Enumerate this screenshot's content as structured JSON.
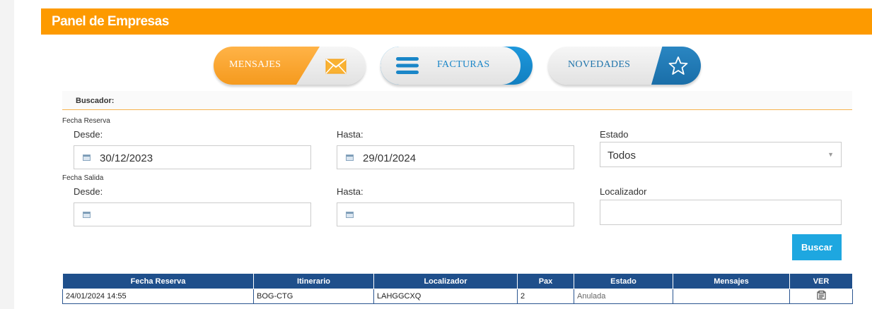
{
  "header": {
    "title": "Panel de Empresas"
  },
  "tabs": [
    {
      "label": "MENSAJES",
      "icon": "envelope-icon"
    },
    {
      "label": "FACTURAS",
      "icon": "menu-lines-icon"
    },
    {
      "label": "NOVEDADES",
      "icon": "star-icon"
    }
  ],
  "search": {
    "title": "Buscador:",
    "fecha_reserva": {
      "label": "Fecha Reserva",
      "desde_label": "Desde:",
      "desde_value": "30/12/2023",
      "hasta_label": "Hasta:",
      "hasta_value": "29/01/2024"
    },
    "estado": {
      "label": "Estado",
      "selected": "Todos"
    },
    "fecha_salida": {
      "label": "Fecha Salida",
      "desde_label": "Desde:",
      "desde_value": "",
      "hasta_label": "Hasta:",
      "hasta_value": ""
    },
    "localizador": {
      "label": "Localizador",
      "value": ""
    },
    "submit_label": "Buscar"
  },
  "table": {
    "columns": [
      "Fecha Reserva",
      "Itinerario",
      "Localizador",
      "Pax",
      "Estado",
      "Mensajes",
      "VER"
    ],
    "rows": [
      {
        "fecha_reserva": "24/01/2024 14:55",
        "itinerario": "BOG-CTG",
        "localizador": "LAHGGCXQ",
        "pax": "2",
        "estado": "Anulada",
        "mensajes": "",
        "ver_icon": "view-document-icon"
      }
    ]
  },
  "colors": {
    "header": "#fd9a00",
    "mensajes_accent": "#f59a1e",
    "facturas_accent": "#1a86c8",
    "novedades_accent": "#1a6ea8",
    "buscar_button": "#1ea7e0",
    "table_header": "#1f4f8b"
  }
}
